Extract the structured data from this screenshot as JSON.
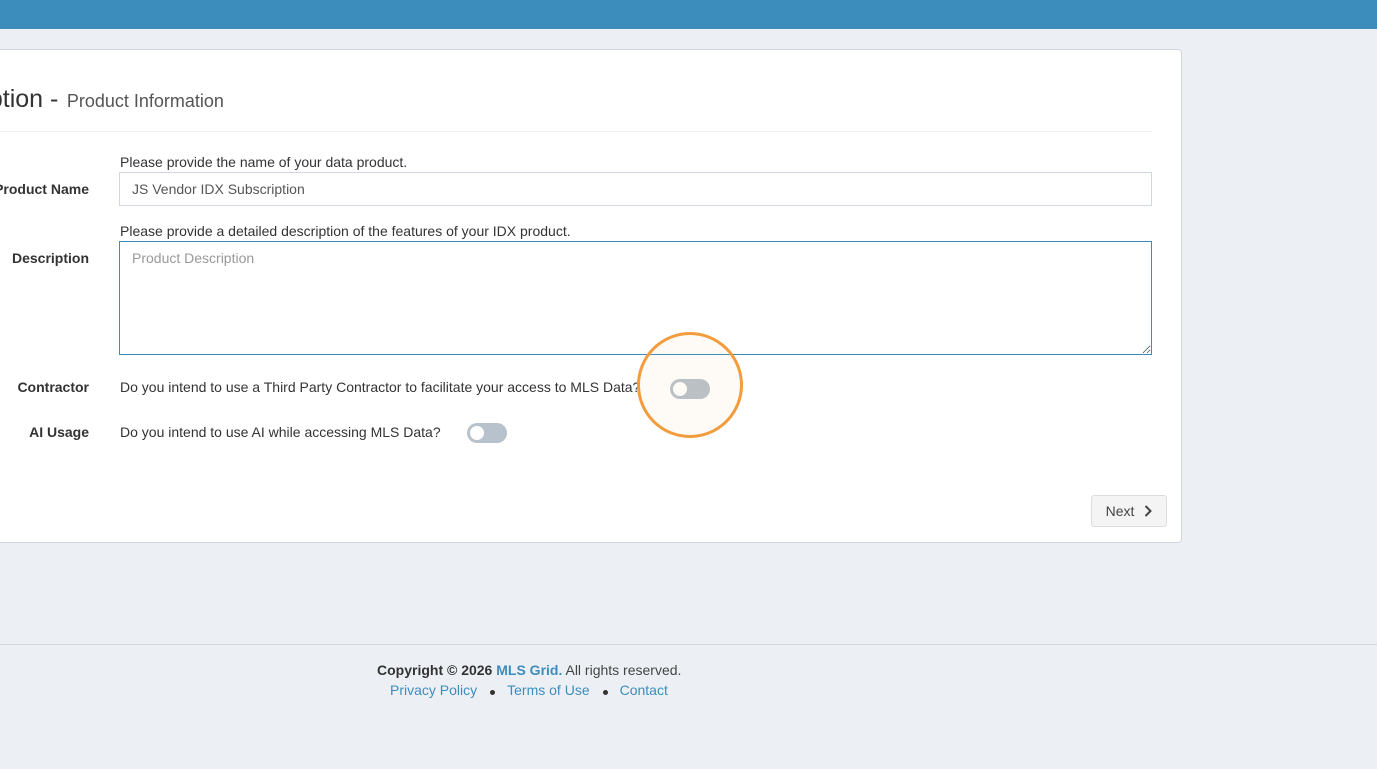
{
  "header": {
    "color": "#3c8dbc"
  },
  "page": {
    "title": "scription -",
    "subtitle": "Product Information"
  },
  "form": {
    "product_name": {
      "label": "Product Name",
      "help": "Please provide the name of your data product.",
      "value": "JS Vendor IDX Subscription"
    },
    "description": {
      "label": "Description",
      "help": "Please provide a detailed description of the features of your IDX product.",
      "placeholder": "Product Description",
      "value": ""
    },
    "contractor": {
      "label": "Contractor",
      "question": "Do you intend to use a Third Party Contractor to facilitate your access to MLS Data?",
      "enabled": false
    },
    "ai_usage": {
      "label": "AI Usage",
      "question": "Do you intend to use AI while accessing MLS Data?",
      "enabled": false
    }
  },
  "actions": {
    "next_label": "Next",
    "next_icon": "chevron-right-icon"
  },
  "footer": {
    "copyright_prefix": "Copyright © 2026",
    "brand": "MLS Grid.",
    "rights": "All rights reserved.",
    "links": [
      "Privacy Policy",
      "Terms of Use",
      "Contact"
    ]
  },
  "colors": {
    "accent": "#3c8dbc",
    "highlight": "#f39c3d",
    "toggle_off": "#b8c2cc"
  }
}
